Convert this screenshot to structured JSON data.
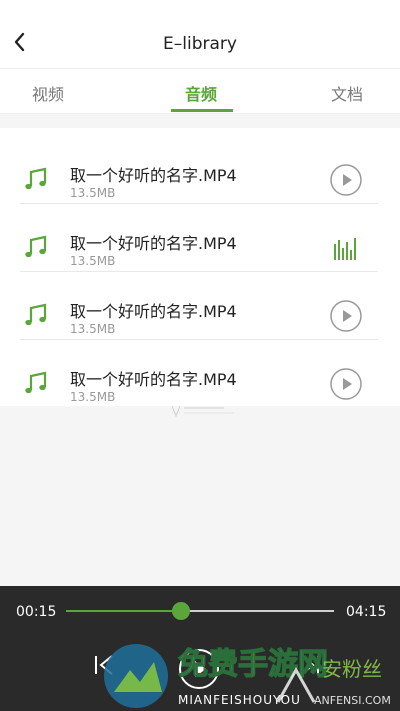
{
  "header": {
    "title": "E–library"
  },
  "tabs": [
    {
      "label": "视频",
      "active": false
    },
    {
      "label": "音频",
      "active": true
    },
    {
      "label": "文档",
      "active": false
    }
  ],
  "files": [
    {
      "name": "取一个好听的名字.MP4",
      "size": "13.5MB",
      "state": "paused"
    },
    {
      "name": "取一个好听的名字.MP4",
      "size": "13.5MB",
      "state": "playing"
    },
    {
      "name": "取一个好听的名字.MP4",
      "size": "13.5MB",
      "state": "paused"
    },
    {
      "name": "取一个好听的名字.MP4",
      "size": "13.5MB",
      "state": "paused"
    }
  ],
  "player": {
    "current_time": "00:15",
    "total_time": "04:15",
    "progress": 0.43
  },
  "watermark": {
    "cn": "免费手游网",
    "cn_secondary": "安粉丝",
    "en": "MIANFEISHOUYOU",
    "en_secondary": "ANFENSI.COM"
  },
  "icons": {
    "back": "chevron-left-icon",
    "file": "music-note-icon",
    "play": "play-circle-icon",
    "playing": "equalizer-icon",
    "prev": "previous-icon",
    "next": "next-icon"
  },
  "colors": {
    "accent": "#5aa63b",
    "player_bg": "#2a2a2a"
  }
}
